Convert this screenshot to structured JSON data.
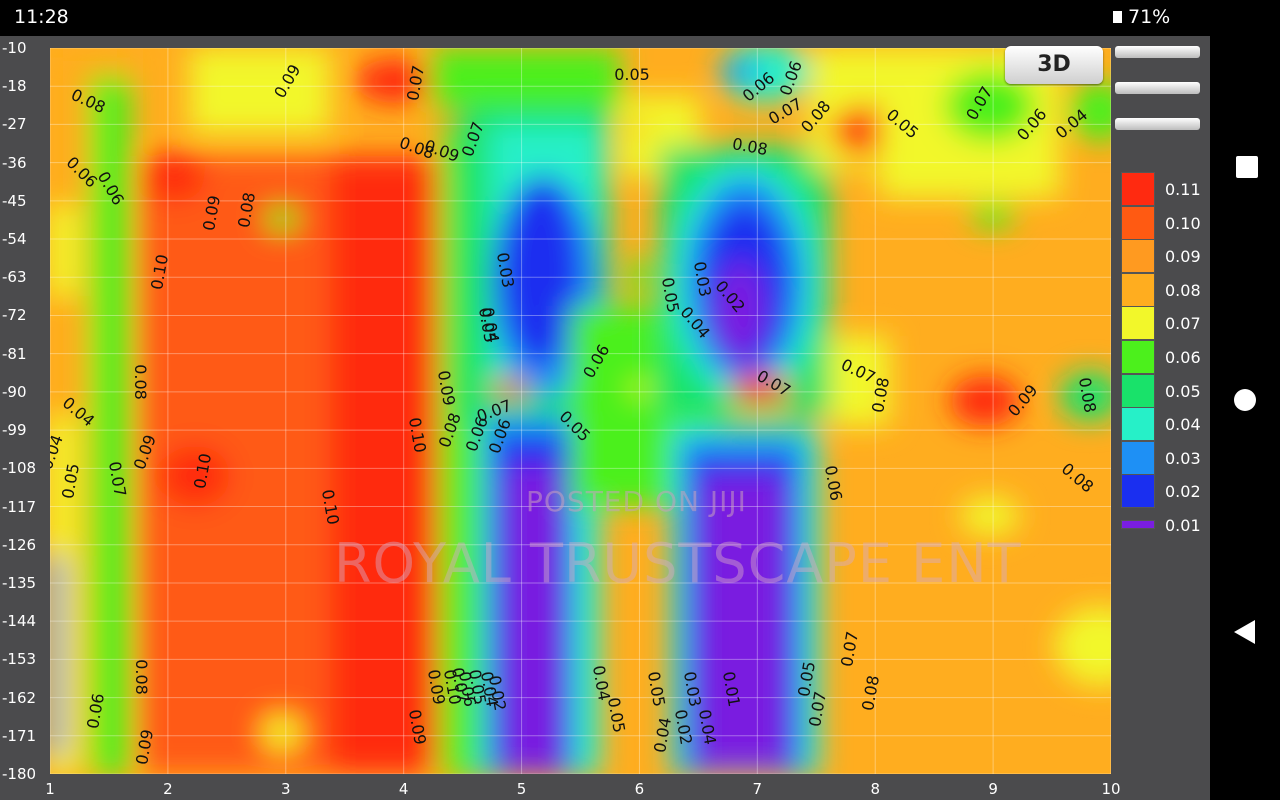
{
  "status_bar": {
    "time": "11:28",
    "battery": "71%"
  },
  "toolbar": {
    "view_3d_label": "3D"
  },
  "y_axis": {
    "ticks": [
      "-10",
      "-18",
      "-27",
      "-36",
      "-45",
      "-54",
      "-63",
      "-72",
      "-81",
      "-90",
      "-99",
      "-108",
      "-117",
      "-126",
      "-135",
      "-144",
      "-153",
      "-162",
      "-171",
      "-180"
    ]
  },
  "x_axis": {
    "ticks": [
      "1",
      "2",
      "3",
      "4",
      "5",
      "6",
      "7",
      "8",
      "9",
      "10"
    ]
  },
  "legend": {
    "levels": [
      {
        "label": "0.11",
        "color": "#ff2a10"
      },
      {
        "label": "0.10",
        "color": "#ff5a12"
      },
      {
        "label": "0.09",
        "color": "#ff9a20"
      },
      {
        "label": "0.08",
        "color": "#ffad1f"
      },
      {
        "label": "0.07",
        "color": "#f2f72a"
      },
      {
        "label": "0.06",
        "color": "#4cf01c"
      },
      {
        "label": "0.05",
        "color": "#19e26a"
      },
      {
        "label": "0.04",
        "color": "#26f0c8"
      },
      {
        "label": "0.03",
        "color": "#1e90f5"
      },
      {
        "label": "0.02",
        "color": "#1a2ff0"
      },
      {
        "label": "0.01",
        "color": "#7a1ee0"
      }
    ]
  },
  "watermark": {
    "small": "POSTED ON JIJI",
    "large": "ROYAL TRUSTSCAPE ENT"
  },
  "contour_labels": [
    "0.08",
    "0.09",
    "0.07",
    "0.05",
    "0.06",
    "0.06",
    "0.08",
    "0.09",
    "0.07",
    "0.08",
    "0.08",
    "0.07",
    "0.06",
    "0.06",
    "0.07",
    "0.06",
    "0.04",
    "0.05",
    "0.09",
    "0.08",
    "0.10",
    "0.03",
    "0.04",
    "0.05",
    "0.05",
    "0.03",
    "0.04",
    "0.02",
    "0.06",
    "0.07",
    "0.07",
    "0.08",
    "0.08",
    "0.09",
    "0.08",
    "0.09",
    "0.10",
    "0.08",
    "0.07",
    "0.06",
    "0.05",
    "0.04",
    "0.06",
    "0.09",
    "0.10",
    "0.04",
    "0.05",
    "0.07",
    "0.10",
    "0.06",
    "0.08",
    "0.07",
    "0.08",
    "0.09",
    "0.06",
    "0.09",
    "0.09",
    "0.10",
    "0.07",
    "0.06",
    "0.05",
    "0.04",
    "0.02",
    "0.04",
    "0.05",
    "0.05",
    "0.03",
    "0.02",
    "0.04",
    "0.01",
    "0.04",
    "0.05",
    "0.07",
    "0.08"
  ]
}
